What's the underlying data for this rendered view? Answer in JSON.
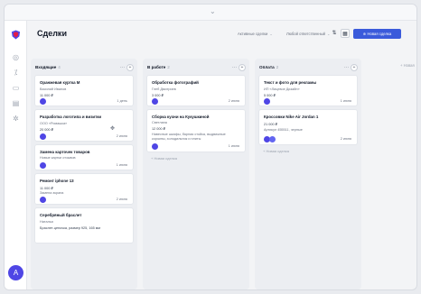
{
  "window": {
    "collapse_icon": "chevron-down-icon",
    "chevron": "⌄"
  },
  "sidebar": {
    "logo_icon": "shield-logo-icon",
    "items": [
      {
        "icon": "circle-dot-icon",
        "glyph": "◎"
      },
      {
        "icon": "signal-icon",
        "glyph": "⁒"
      },
      {
        "icon": "calendar-icon",
        "glyph": "▭"
      },
      {
        "icon": "document-icon",
        "glyph": "▤"
      },
      {
        "icon": "settings-icon",
        "glyph": "✲"
      }
    ],
    "avatar_initial": "А"
  },
  "header": {
    "title": "Сделки",
    "filter_active": "Активные сделки",
    "filter_owner": "Любой ответственный",
    "dropdown_glyph": "⌄",
    "settings_icon": "sliders-icon",
    "settings_glyph": "⇅",
    "grid_icon": "grid-icon",
    "grid_glyph": "▦",
    "new_deal_label": "⊕ Новая сделка"
  },
  "accent": "#3b5bdb",
  "columns": [
    {
      "title": "Входящие",
      "count": "4",
      "cards": [
        {
          "title": "Оранжевая куртка M",
          "lines": [
            "Василий Иванов",
            "11 000 ₽"
          ],
          "date": "1 день"
        },
        {
          "title": "Разработка логотипа и визитки",
          "lines": [
            "ООО «Ромашка»",
            "20 000 ₽"
          ],
          "date": "2 июня"
        },
        {
          "title": "Замена карточек товаров",
          "lines": [
            "Новые картки отзывов"
          ],
          "date": "1 июня"
        },
        {
          "title": "Ремонт iphone 13",
          "lines": [
            "11 000 ₽",
            "Замена экрана"
          ],
          "date": "2 июня"
        },
        {
          "title": "Серебряный браслет",
          "lines": [
            "Наталья",
            "Браслет-цепочка, размер 925, 165 мм"
          ],
          "date": ""
        }
      ]
    },
    {
      "title": "В работе",
      "count": "2",
      "cards": [
        {
          "title": "Обработка фотографий",
          "lines": [
            "Глеб Дмитриев",
            "3 000 ₽"
          ],
          "date": "2 июня"
        },
        {
          "title": "Сборка кухни на Кукушкиной",
          "lines": [
            "Светлана",
            "12 000 ₽",
            "Навесные шкафы, барная стойка, выдвижные",
            "корзины, холодильник и плиты"
          ],
          "date": "1 июня"
        }
      ],
      "add_label": "+ Новая сделка"
    },
    {
      "title": "Оплата",
      "count": "2",
      "cards": [
        {
          "title": "Текст и фото для рекламы",
          "lines": [
            "ИП «Лицевое Дизайн»",
            "5 000 ₽"
          ],
          "date": "1 июня"
        },
        {
          "title": "Кроссовки Nike Air Jordan 1",
          "lines": [
            "21 000 ₽",
            "Артикул 455511, черные"
          ],
          "date": "2 июня"
        }
      ],
      "add_label": "+ Новая сделка"
    }
  ],
  "new_column_label": "+ Новая"
}
